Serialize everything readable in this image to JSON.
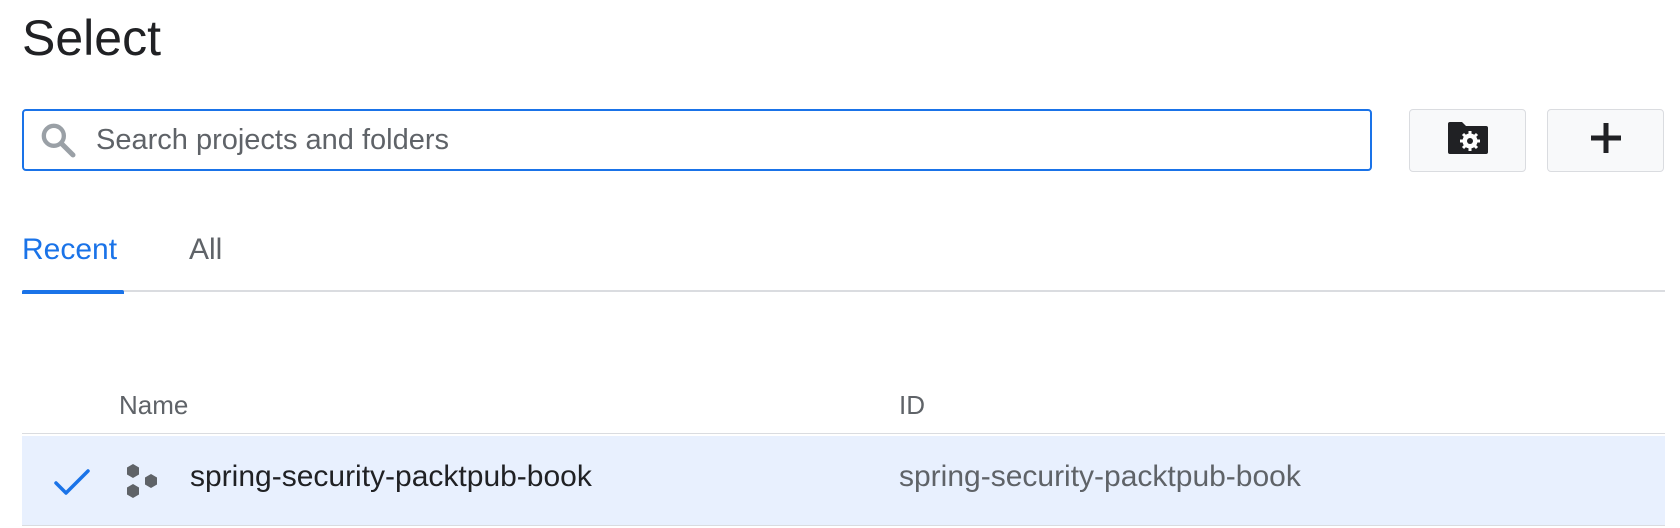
{
  "dialog": {
    "title": "Select"
  },
  "search": {
    "placeholder": "Search projects and folders",
    "value": ""
  },
  "toolbar": {
    "folder_settings_icon": "folder-gear-icon",
    "add_icon": "plus-icon"
  },
  "tabs": [
    {
      "label": "Recent",
      "active": true
    },
    {
      "label": "All",
      "active": false
    }
  ],
  "table": {
    "columns": [
      "Name",
      "ID"
    ],
    "rows": [
      {
        "selected": true,
        "icon": "project-hexagons-icon",
        "name": "spring-security-packtpub-book",
        "id": "spring-security-packtpub-book"
      }
    ]
  },
  "colors": {
    "accent": "#1a73e8",
    "selected_row_bg": "#e8f0fe",
    "muted_text": "#5f6368"
  }
}
